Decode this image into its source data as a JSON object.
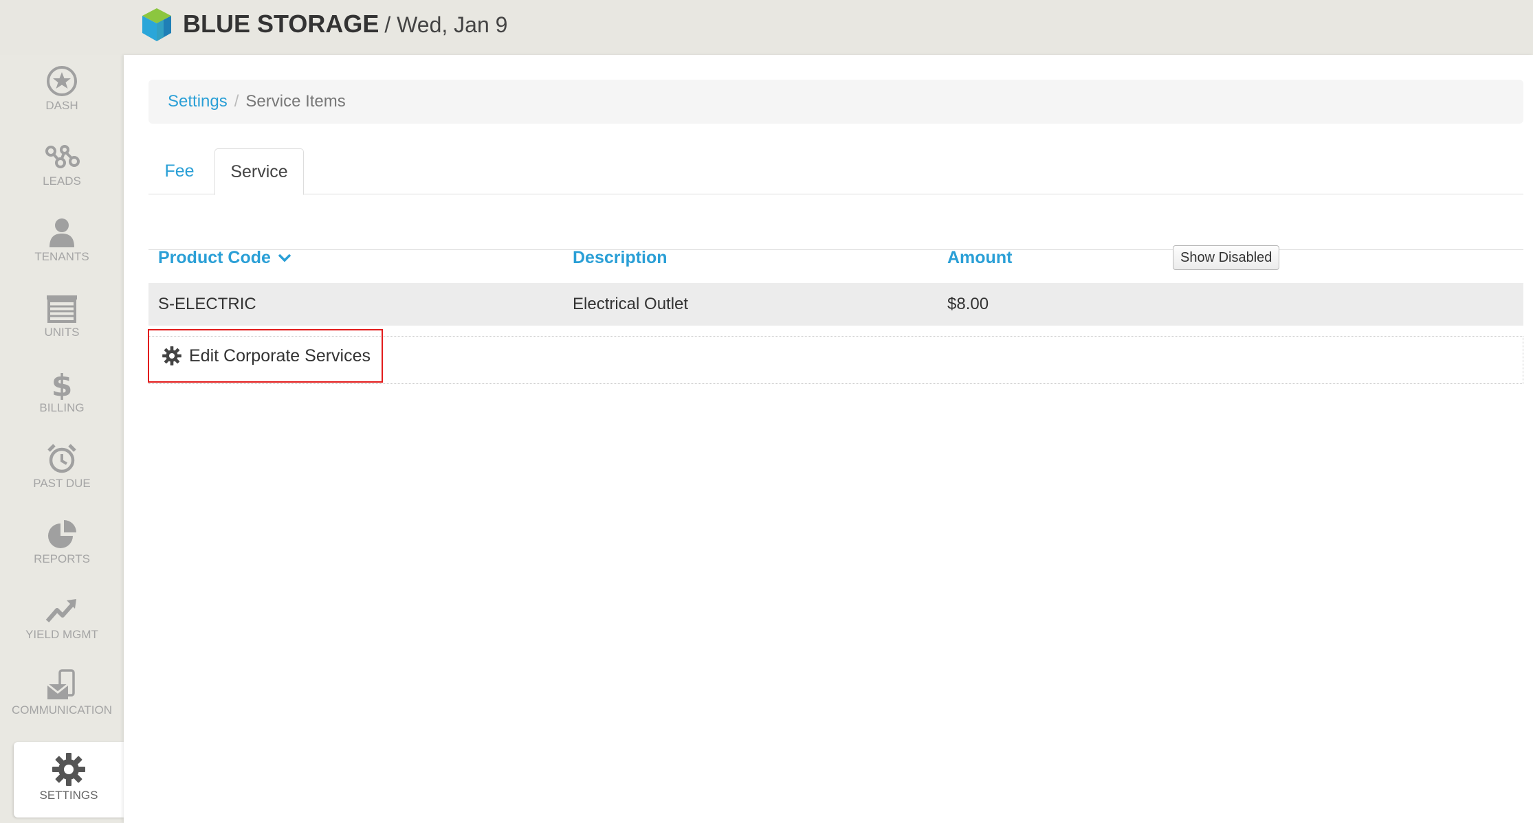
{
  "header": {
    "brand": "BLUE STORAGE",
    "date": "/ Wed, Jan 9"
  },
  "sidebar": {
    "items": [
      {
        "label": "DASH",
        "icon": "star-circle-icon"
      },
      {
        "label": "LEADS",
        "icon": "network-icon"
      },
      {
        "label": "TENANTS",
        "icon": "person-icon"
      },
      {
        "label": "UNITS",
        "icon": "storage-unit-icon"
      },
      {
        "label": "BILLING",
        "icon": "dollar-icon"
      },
      {
        "label": "PAST DUE",
        "icon": "alarm-clock-icon"
      },
      {
        "label": "REPORTS",
        "icon": "pie-chart-icon"
      },
      {
        "label": "YIELD MGMT",
        "icon": "trend-up-icon"
      },
      {
        "label": "COMMUNICATION",
        "icon": "phone-mail-icon"
      },
      {
        "label": "SETTINGS",
        "icon": "gear-icon",
        "active": true
      }
    ]
  },
  "breadcrumb": {
    "parent": "Settings",
    "separator": "/",
    "current": "Service Items"
  },
  "tabs": [
    {
      "label": "Fee",
      "active": false
    },
    {
      "label": "Service",
      "active": true
    }
  ],
  "table": {
    "columns": {
      "code": "Product Code",
      "description": "Description",
      "amount": "Amount"
    },
    "show_disabled_label": "Show Disabled",
    "rows": [
      {
        "code": "S-ELECTRIC",
        "description": "Electrical Outlet",
        "amount": "$8.00"
      }
    ]
  },
  "actions": {
    "edit_corporate": "Edit Corporate Services"
  },
  "colors": {
    "accent": "#2a9fd6",
    "highlight": "#e21b1b"
  }
}
